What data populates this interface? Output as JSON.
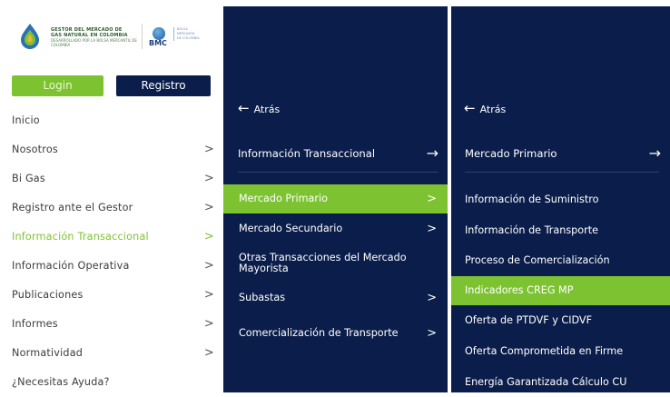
{
  "logos": {
    "gestor_line1": "GESTOR DEL MERCADO DE",
    "gestor_line2": "GAS NATURAL EN COLOMBIA",
    "gestor_line3": "DESARROLLADO POR LA BOLSA MERCANTIL DE COLOMBIA",
    "bmc_word": "BMC",
    "bmc_side": [
      "BOLSA",
      "MERCANTIL",
      "DE COLOMBIA"
    ]
  },
  "auth": {
    "login_label": "Login",
    "registro_label": "Registro"
  },
  "nav1": [
    {
      "label": "Inicio",
      "chevron": ""
    },
    {
      "label": "Nosotros",
      "chevron": ">"
    },
    {
      "label": "Bi Gas",
      "chevron": ">"
    },
    {
      "label": "Registro ante el Gestor",
      "chevron": ">"
    },
    {
      "label": "Información Transaccional",
      "chevron": ">",
      "active": true
    },
    {
      "label": "Información Operativa",
      "chevron": ">"
    },
    {
      "label": "Publicaciones",
      "chevron": ">"
    },
    {
      "label": "Informes",
      "chevron": ">"
    },
    {
      "label": "Normatividad",
      "chevron": ">"
    },
    {
      "label": "¿Necesitas Ayuda?",
      "chevron": ""
    }
  ],
  "panel2": {
    "back_label": "Atrás",
    "heading": "Información Transaccional",
    "items": [
      {
        "label": "Mercado Primario",
        "chevron": ">",
        "active": true
      },
      {
        "label": "Mercado Secundario",
        "chevron": ">"
      },
      {
        "label": "Otras Transacciones del Mercado Mayorista",
        "chevron": ""
      },
      {
        "label": "Subastas",
        "chevron": ">"
      },
      {
        "label": "Comercialización de Transporte",
        "chevron": ">"
      }
    ]
  },
  "panel3": {
    "back_label": "Atrás",
    "heading": "Mercado Primario",
    "items": [
      {
        "label": "Información de Suministro"
      },
      {
        "label": "Información de Transporte"
      },
      {
        "label": "Proceso de Comercialización"
      },
      {
        "label": "Indicadores CREG MP",
        "active": true
      },
      {
        "label": "Oferta de PTDVF y CIDVF"
      },
      {
        "label": "Oferta Comprometida en Firme"
      },
      {
        "label": "Energía Garantizada Cálculo CU"
      }
    ]
  },
  "colors": {
    "navy": "#0b1d4b",
    "green": "#7dc331",
    "text": "#3c3c3c"
  },
  "icons": {
    "back": "arrow-left-icon",
    "forward": "arrow-right-icon",
    "chevron": "chevron-right-icon"
  }
}
